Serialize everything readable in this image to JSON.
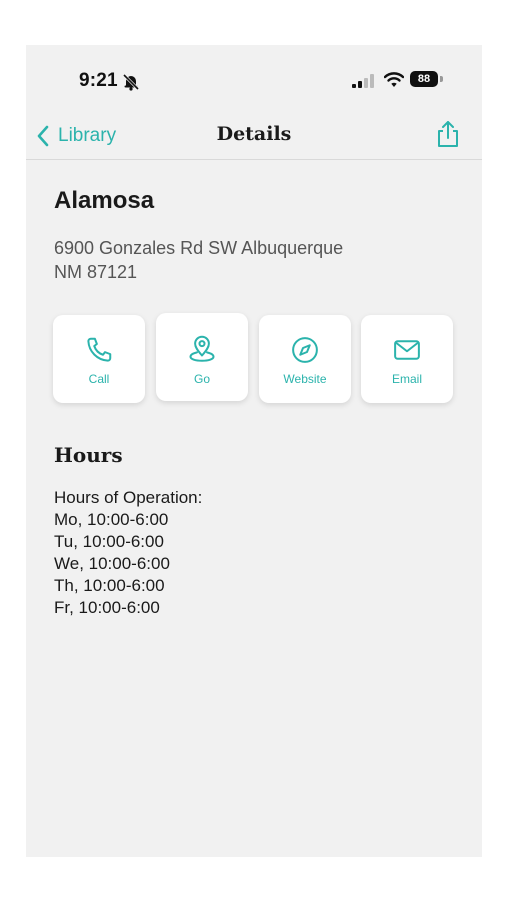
{
  "status_bar": {
    "time": "9:21",
    "battery": "88"
  },
  "nav": {
    "back_label": "Library",
    "title": "Details"
  },
  "place": {
    "name": "Alamosa",
    "address_line1": "6900 Gonzales Rd SW Albuquerque",
    "address_line2": "NM 87121"
  },
  "actions": [
    {
      "label": "Call",
      "icon": "phone-icon"
    },
    {
      "label": "Go",
      "icon": "map-pin-icon"
    },
    {
      "label": "Website",
      "icon": "compass-icon"
    },
    {
      "label": "Email",
      "icon": "envelope-icon"
    }
  ],
  "hours": {
    "title": "Hours",
    "header": "Hours of Operation:",
    "lines": [
      "Mo, 10:00-6:00",
      "Tu, 10:00-6:00",
      "We, 10:00-6:00",
      "Th, 10:00-6:00",
      "Fr, 10:00-6:00"
    ]
  },
  "colors": {
    "accent": "#2bb3ac",
    "background": "#f1f1f1",
    "card": "#ffffff"
  }
}
